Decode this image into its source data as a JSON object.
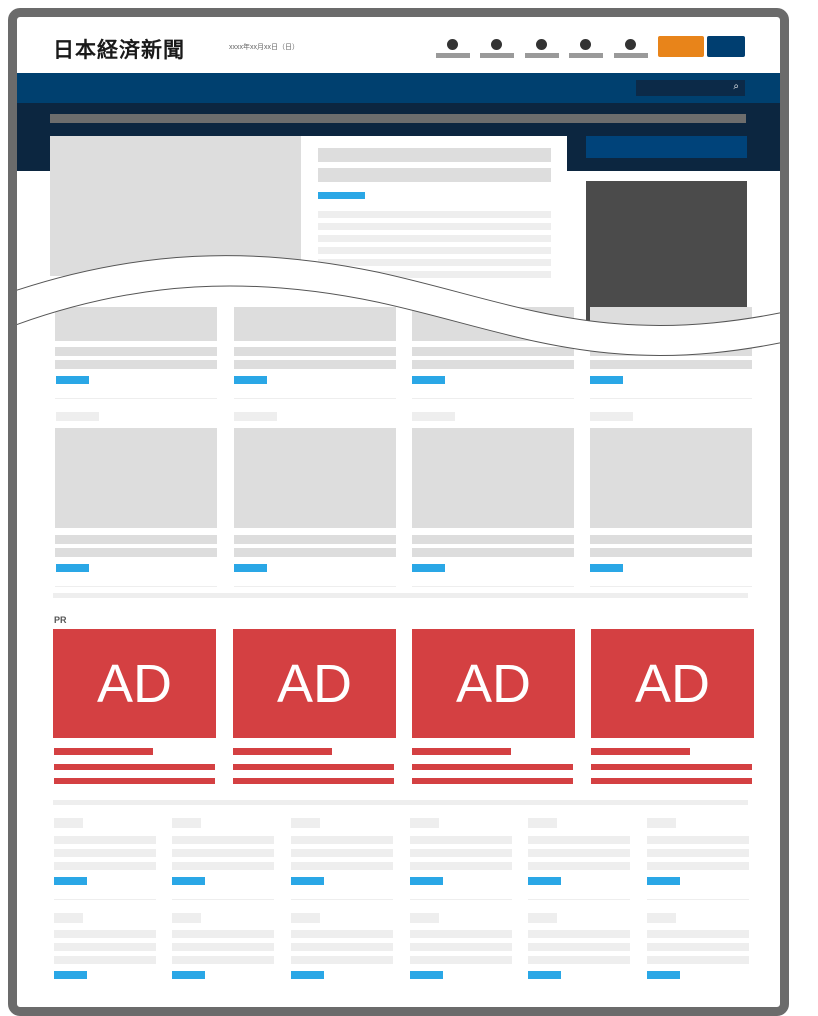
{
  "header": {
    "logo_text": "日本経済新聞",
    "date_text": "xxxx年xx月xx日（日）",
    "nav_icons": [
      "nav-icon-1",
      "nav-icon-2",
      "nav-icon-3",
      "nav-icon-4",
      "nav-icon-5"
    ]
  },
  "search": {
    "icon": "search-icon",
    "glyph": "⌕"
  },
  "ads": {
    "section_label": "PR",
    "items": [
      {
        "label": "AD"
      },
      {
        "label": "AD"
      },
      {
        "label": "AD"
      },
      {
        "label": "AD"
      }
    ]
  },
  "colors": {
    "accent_navy": "#00406f",
    "accent_orange": "#e8841a",
    "link_blue": "#2aa7e6",
    "ad_red": "#d44042"
  }
}
